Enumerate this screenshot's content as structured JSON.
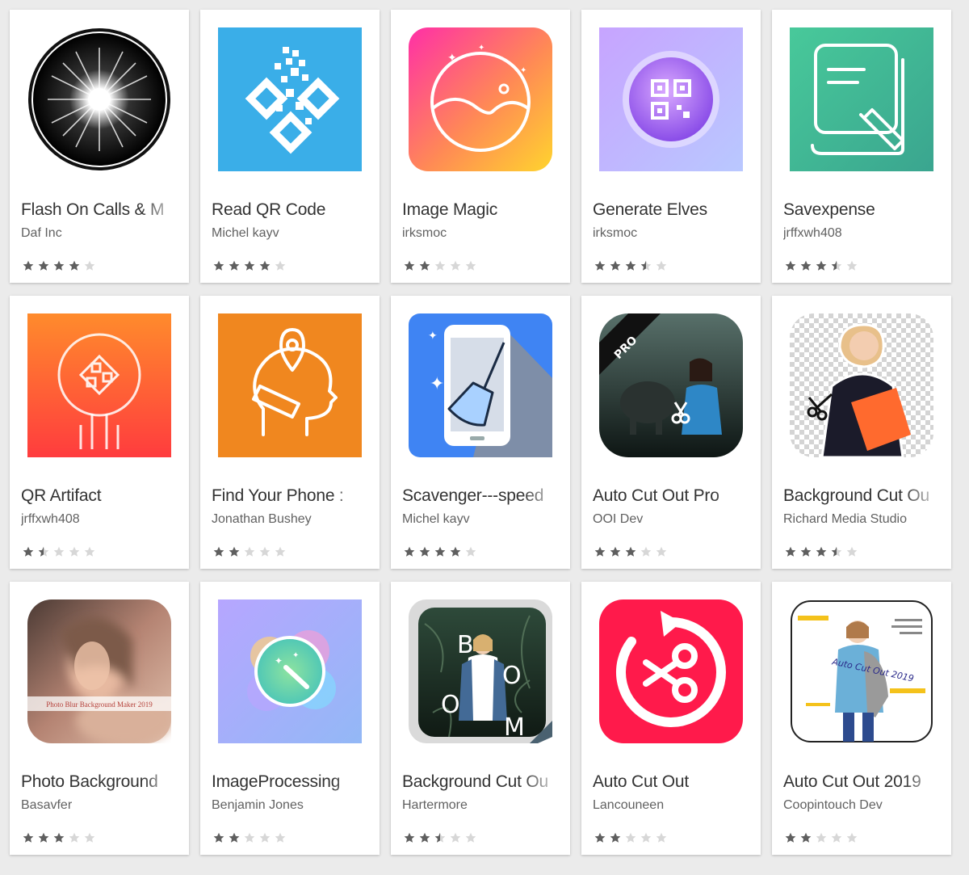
{
  "apps": [
    {
      "title": "Flash On Calls & M",
      "developer": "Daf Inc",
      "rating": 4,
      "icon": "flash-burst-icon",
      "colors": [
        "#000000",
        "#ffffff"
      ]
    },
    {
      "title": "Read QR Code",
      "developer": "Michel kayv",
      "rating": 4,
      "icon": "qr-code-icon",
      "colors": [
        "#3aaee8"
      ]
    },
    {
      "title": "Image Magic",
      "developer": "irksmoc",
      "rating": 2,
      "icon": "landscape-circle-icon",
      "colors": [
        "#ff3d9a",
        "#ffd42e"
      ]
    },
    {
      "title": "Generate Elves",
      "developer": "irksmoc",
      "rating": 3.5,
      "icon": "qr-orb-icon",
      "colors": [
        "#c9b3ff",
        "#9b6cf5"
      ]
    },
    {
      "title": "Savexpense",
      "developer": "jrffxwh408",
      "rating": 3.5,
      "icon": "document-pen-icon",
      "colors": [
        "#47c59a",
        "#39a88d"
      ]
    },
    {
      "title": "QR Artifact",
      "developer": "jrffxwh408",
      "rating": 1.5,
      "icon": "qr-rocket-icon",
      "colors": [
        "#ff8a2b",
        "#ff3d3d"
      ]
    },
    {
      "title": "Find Your Phone :",
      "developer": "Jonathan Bushey",
      "rating": 2,
      "icon": "phone-location-icon",
      "colors": [
        "#f58320",
        "#e8901f"
      ]
    },
    {
      "title": "Scavenger---speed",
      "developer": "Michel kayv",
      "rating": 4,
      "icon": "phone-broom-icon",
      "colors": [
        "#3f82f2",
        "#7f8fa8"
      ]
    },
    {
      "title": "Auto Cut Out Pro",
      "developer": "OOI Dev",
      "rating": 3,
      "icon": "photo-scissors-icon",
      "colors": [
        "#1f2a2a",
        "#3b5b56"
      ]
    },
    {
      "title": "Background Cut Ou",
      "developer": "Richard Media Studio",
      "rating": 3.5,
      "icon": "person-cutout-icon",
      "colors": [
        "#ff6a2e",
        "#1b1b2a"
      ]
    },
    {
      "title": "Photo Background",
      "developer": "Basavfer",
      "rating": 3,
      "icon": "blurred-portrait-icon",
      "colors": [
        "#c99a84",
        "#6e4a3e"
      ]
    },
    {
      "title": "ImageProcessing",
      "developer": "Benjamin Jones",
      "rating": 2,
      "icon": "magic-wand-icon",
      "colors": [
        "#9fb0f5",
        "#6ed9a7"
      ]
    },
    {
      "title": "Background Cut Ou",
      "developer": "Hartermore",
      "rating": 2.5,
      "icon": "jungle-portrait-icon",
      "colors": [
        "#1e2f26",
        "#56705e"
      ]
    },
    {
      "title": "Auto Cut Out",
      "developer": "Lancouneen",
      "rating": 2,
      "icon": "circular-scissors-icon",
      "colors": [
        "#ff1a4b"
      ]
    },
    {
      "title": "Auto Cut Out 2019",
      "developer": "Coopintouch Dev",
      "rating": 2,
      "icon": "fashion-cutout-icon",
      "colors": [
        "#f4c21b",
        "#888888"
      ]
    }
  ],
  "icon_texts": {
    "pro_badge": "PRO",
    "blur_caption": "Photo Blur Background Maker 2019",
    "autocut_caption": "Auto Cut Out 2019",
    "boom_letters": [
      "B",
      "O",
      "O",
      "M"
    ]
  },
  "star_colors": {
    "filled": "#5f5f5f",
    "empty": "#d7d7d7"
  }
}
